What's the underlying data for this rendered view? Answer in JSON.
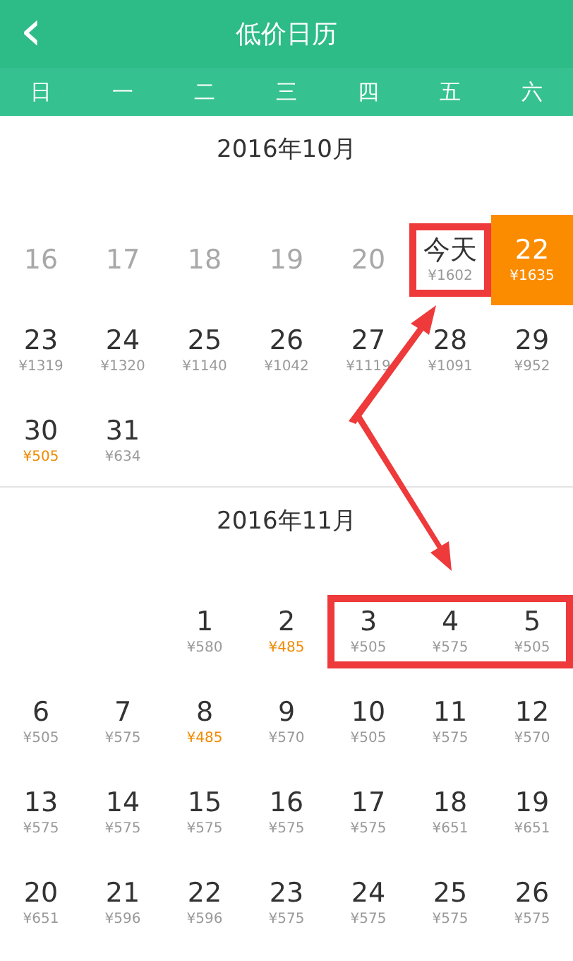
{
  "header": {
    "back": "‹",
    "title": "低价日历"
  },
  "weekdays": [
    "日",
    "一",
    "二",
    "三",
    "四",
    "五",
    "六"
  ],
  "months": [
    {
      "title": "2016年10月",
      "weeks": [
        [
          {
            "kind": "past",
            "day": "16",
            "selected": false
          },
          {
            "kind": "past",
            "day": "17",
            "selected": false
          },
          {
            "kind": "past",
            "day": "18",
            "selected": false
          },
          {
            "kind": "past",
            "day": "19",
            "selected": false
          },
          {
            "kind": "past",
            "day": "20",
            "selected": false
          },
          {
            "kind": "today",
            "day": "今天",
            "price": "¥1602",
            "cheap": false,
            "selected": false,
            "highlighted": true
          },
          {
            "kind": "day",
            "day": "22",
            "price": "¥1635",
            "cheap": false,
            "selected": true
          }
        ],
        [
          {
            "kind": "day",
            "day": "23",
            "price": "¥1319",
            "cheap": false,
            "selected": false
          },
          {
            "kind": "day",
            "day": "24",
            "price": "¥1320",
            "cheap": false,
            "selected": false
          },
          {
            "kind": "day",
            "day": "25",
            "price": "¥1140",
            "cheap": false,
            "selected": false
          },
          {
            "kind": "day",
            "day": "26",
            "price": "¥1042",
            "cheap": false,
            "selected": false
          },
          {
            "kind": "day",
            "day": "27",
            "price": "¥1119",
            "cheap": false,
            "selected": false
          },
          {
            "kind": "day",
            "day": "28",
            "price": "¥1091",
            "cheap": false,
            "selected": false
          },
          {
            "kind": "day",
            "day": "29",
            "price": "¥952",
            "cheap": false,
            "selected": false
          }
        ],
        [
          {
            "kind": "day",
            "day": "30",
            "price": "¥505",
            "cheap": true,
            "selected": false
          },
          {
            "kind": "day",
            "day": "31",
            "price": "¥634",
            "cheap": false,
            "selected": false
          },
          {
            "kind": "blank"
          },
          {
            "kind": "blank"
          },
          {
            "kind": "blank"
          },
          {
            "kind": "blank"
          },
          {
            "kind": "blank"
          }
        ]
      ]
    },
    {
      "title": "2016年11月",
      "weeks": [
        [
          {
            "kind": "blank"
          },
          {
            "kind": "blank"
          },
          {
            "kind": "day",
            "day": "1",
            "price": "¥580",
            "cheap": false,
            "selected": false
          },
          {
            "kind": "day",
            "day": "2",
            "price": "¥485",
            "cheap": true,
            "selected": false
          },
          {
            "kind": "day",
            "day": "3",
            "price": "¥505",
            "cheap": false,
            "selected": false,
            "highlighted": true
          },
          {
            "kind": "day",
            "day": "4",
            "price": "¥575",
            "cheap": false,
            "selected": false,
            "highlighted": true
          },
          {
            "kind": "day",
            "day": "5",
            "price": "¥505",
            "cheap": false,
            "selected": false,
            "highlighted": true
          }
        ],
        [
          {
            "kind": "day",
            "day": "6",
            "price": "¥505",
            "cheap": false,
            "selected": false
          },
          {
            "kind": "day",
            "day": "7",
            "price": "¥575",
            "cheap": false,
            "selected": false
          },
          {
            "kind": "day",
            "day": "8",
            "price": "¥485",
            "cheap": true,
            "selected": false
          },
          {
            "kind": "day",
            "day": "9",
            "price": "¥570",
            "cheap": false,
            "selected": false
          },
          {
            "kind": "day",
            "day": "10",
            "price": "¥505",
            "cheap": false,
            "selected": false
          },
          {
            "kind": "day",
            "day": "11",
            "price": "¥575",
            "cheap": false,
            "selected": false
          },
          {
            "kind": "day",
            "day": "12",
            "price": "¥570",
            "cheap": false,
            "selected": false
          }
        ],
        [
          {
            "kind": "day",
            "day": "13",
            "price": "¥575",
            "cheap": false,
            "selected": false
          },
          {
            "kind": "day",
            "day": "14",
            "price": "¥575",
            "cheap": false,
            "selected": false
          },
          {
            "kind": "day",
            "day": "15",
            "price": "¥575",
            "cheap": false,
            "selected": false
          },
          {
            "kind": "day",
            "day": "16",
            "price": "¥575",
            "cheap": false,
            "selected": false
          },
          {
            "kind": "day",
            "day": "17",
            "price": "¥575",
            "cheap": false,
            "selected": false
          },
          {
            "kind": "day",
            "day": "18",
            "price": "¥651",
            "cheap": false,
            "selected": false
          },
          {
            "kind": "day",
            "day": "19",
            "price": "¥651",
            "cheap": false,
            "selected": false
          }
        ],
        [
          {
            "kind": "day",
            "day": "20",
            "price": "¥651",
            "cheap": false,
            "selected": false
          },
          {
            "kind": "day",
            "day": "21",
            "price": "¥596",
            "cheap": false,
            "selected": false
          },
          {
            "kind": "day",
            "day": "22",
            "price": "¥596",
            "cheap": false,
            "selected": false
          },
          {
            "kind": "day",
            "day": "23",
            "price": "¥575",
            "cheap": false,
            "selected": false
          },
          {
            "kind": "day",
            "day": "24",
            "price": "¥575",
            "cheap": false,
            "selected": false
          },
          {
            "kind": "day",
            "day": "25",
            "price": "¥575",
            "cheap": false,
            "selected": false
          },
          {
            "kind": "day",
            "day": "26",
            "price": "¥575",
            "cheap": false,
            "selected": false
          }
        ]
      ]
    }
  ]
}
